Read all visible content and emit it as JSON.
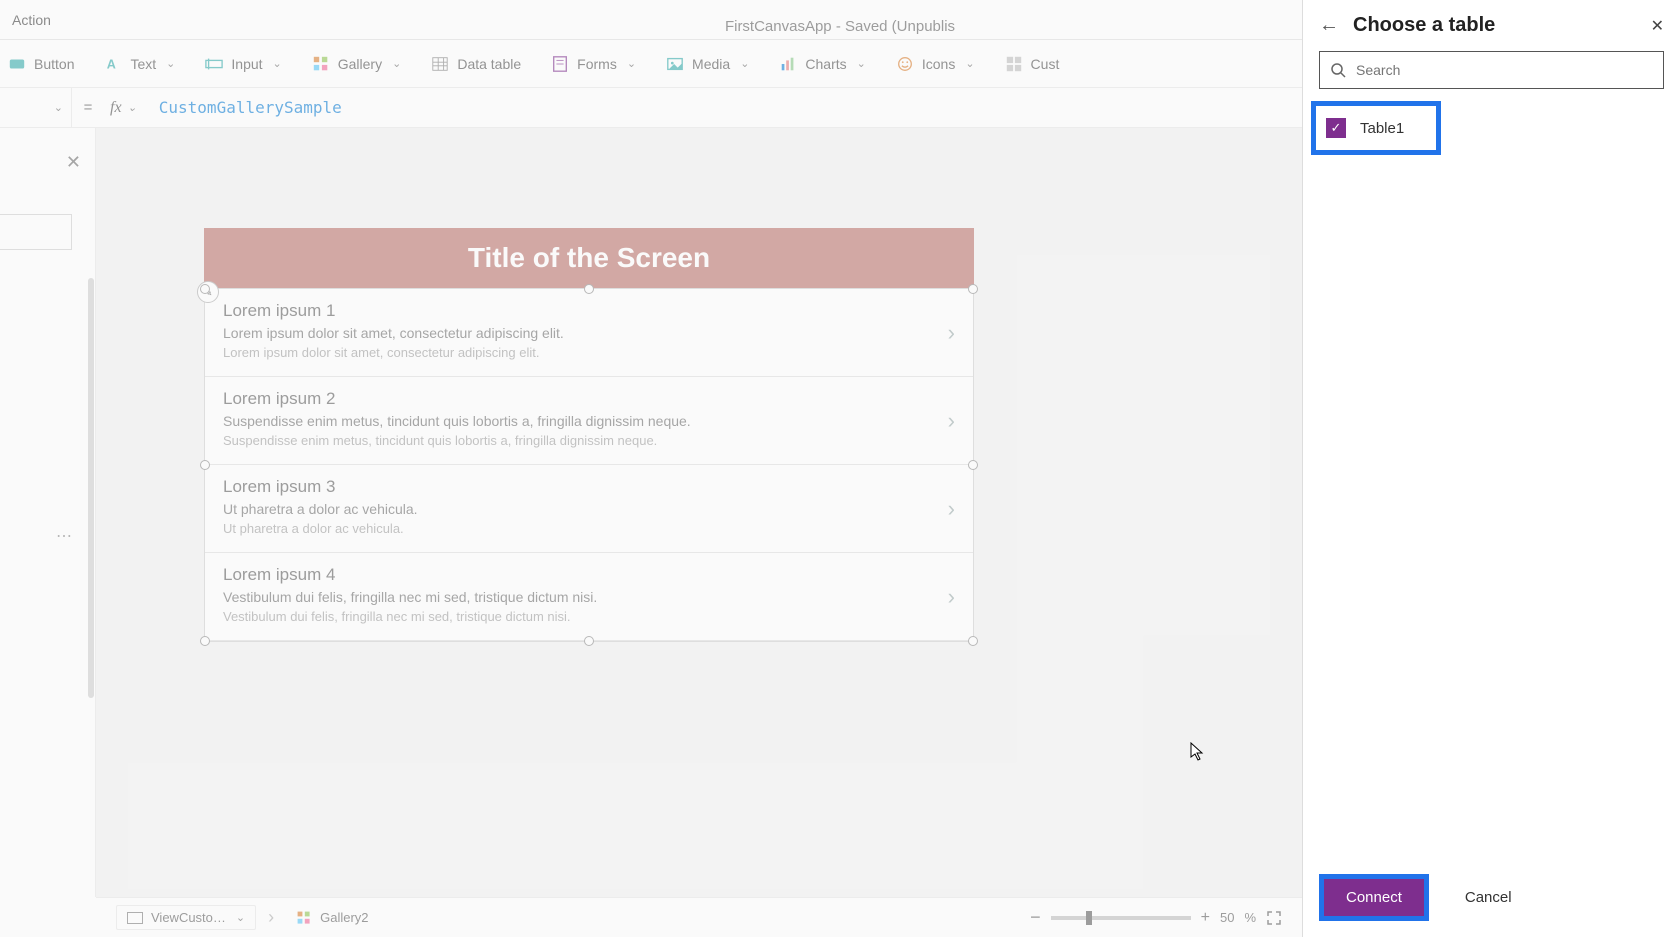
{
  "app_title": "FirstCanvasApp - Saved (Unpublis",
  "tab": {
    "action": "Action"
  },
  "ribbon": {
    "button": "Button",
    "text": "Text",
    "input": "Input",
    "gallery": "Gallery",
    "data_table": "Data table",
    "forms": "Forms",
    "media": "Media",
    "charts": "Charts",
    "icons": "Icons",
    "custom": "Cust"
  },
  "formula": {
    "eq": "=",
    "fx": "fx",
    "expression": "CustomGallerySample"
  },
  "left_panel": {
    "more": "⋯"
  },
  "canvas": {
    "screen_title": "Title of the Screen",
    "items": [
      {
        "title": "Lorem ipsum 1",
        "line2": "Lorem ipsum dolor sit amet, consectetur adipiscing elit.",
        "line3": "Lorem ipsum dolor sit amet, consectetur adipiscing elit."
      },
      {
        "title": "Lorem ipsum 2",
        "line2": "Suspendisse enim metus, tincidunt quis lobortis a, fringilla dignissim neque.",
        "line3": "Suspendisse enim metus, tincidunt quis lobortis a, fringilla dignissim neque."
      },
      {
        "title": "Lorem ipsum 3",
        "line2": "Ut pharetra a dolor ac vehicula.",
        "line3": "Ut pharetra a dolor ac vehicula."
      },
      {
        "title": "Lorem ipsum 4",
        "line2": "Vestibulum dui felis, fringilla nec mi sed, tristique dictum nisi.",
        "line3": "Vestibulum dui felis, fringilla nec mi sed, tristique dictum nisi."
      }
    ]
  },
  "status": {
    "breadcrumb1": "ViewCusto…",
    "breadcrumb2": "Gallery2",
    "zoom_minus": "−",
    "zoom_plus": "+",
    "zoom_value": "50",
    "zoom_pct": "%"
  },
  "sidepanel": {
    "title": "Choose a table",
    "search_placeholder": "Search",
    "tables": [
      {
        "name": "Table1",
        "checked": true
      }
    ],
    "connect": "Connect",
    "cancel": "Cancel"
  }
}
